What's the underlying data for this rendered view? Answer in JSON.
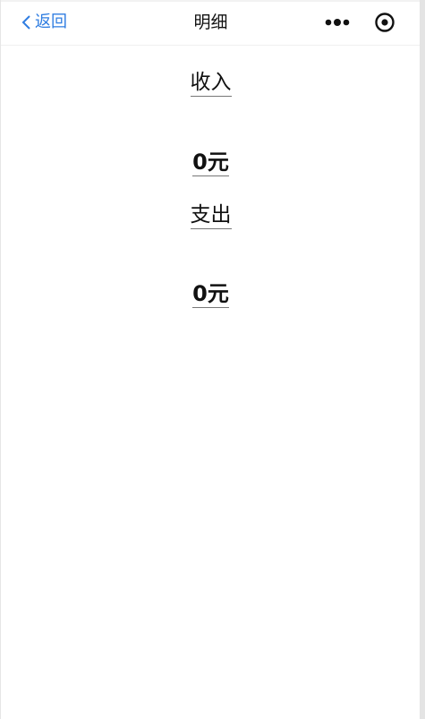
{
  "nav": {
    "back_label": "返回",
    "title": "明细"
  },
  "income": {
    "label": "收入",
    "amount": "0元"
  },
  "expense": {
    "label": "支出",
    "amount": "0元"
  },
  "icons": {
    "back": "chevron-left-icon",
    "more": "more-dots-icon",
    "target": "target-circle-icon"
  },
  "colors": {
    "accent": "#2f7de1",
    "text": "#111111",
    "background": "#ffffff"
  }
}
